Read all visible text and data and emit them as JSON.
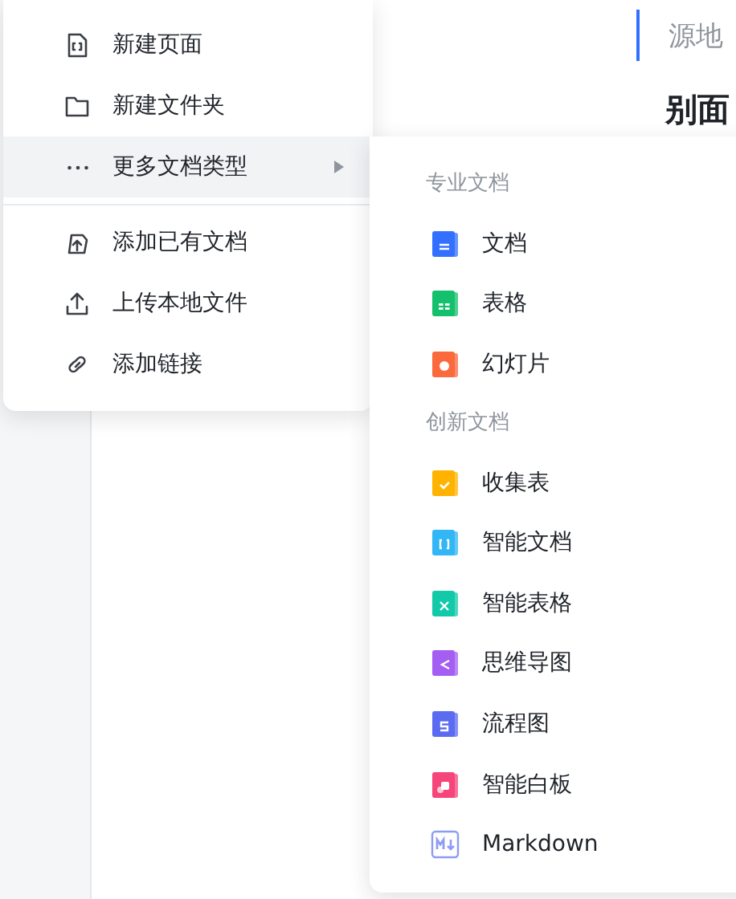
{
  "page": {
    "source_label": "源地",
    "heading": "别面"
  },
  "menu": {
    "groups": [
      [
        {
          "label": "新建页面",
          "selected": false,
          "submenu": false
        },
        {
          "label": "新建文件夹",
          "selected": false,
          "submenu": false
        },
        {
          "label": "更多文档类型",
          "selected": true,
          "submenu": true
        }
      ],
      [
        {
          "label": "添加已有文档",
          "selected": false,
          "submenu": false
        },
        {
          "label": "上传本地文件",
          "selected": false,
          "submenu": false
        },
        {
          "label": "添加链接",
          "selected": false,
          "submenu": false
        }
      ]
    ]
  },
  "submenu": {
    "sections": [
      {
        "title": "专业文档",
        "items": [
          {
            "label": "文档",
            "color": "#3370ff"
          },
          {
            "label": "表格",
            "color": "#14c06b"
          },
          {
            "label": "幻灯片",
            "color": "#fa6a3c"
          }
        ]
      },
      {
        "title": "创新文档",
        "items": [
          {
            "label": "收集表",
            "color": "#ffb300"
          },
          {
            "label": "智能文档",
            "color": "#32b6f5"
          },
          {
            "label": "智能表格",
            "color": "#12c9aa"
          },
          {
            "label": "思维导图",
            "color": "#a45ef2"
          },
          {
            "label": "流程图",
            "color": "#5b6cf0"
          },
          {
            "label": "智能白板",
            "color": "#f5457a"
          },
          {
            "label": "Markdown",
            "color": "#8e9bf5"
          }
        ]
      }
    ]
  }
}
